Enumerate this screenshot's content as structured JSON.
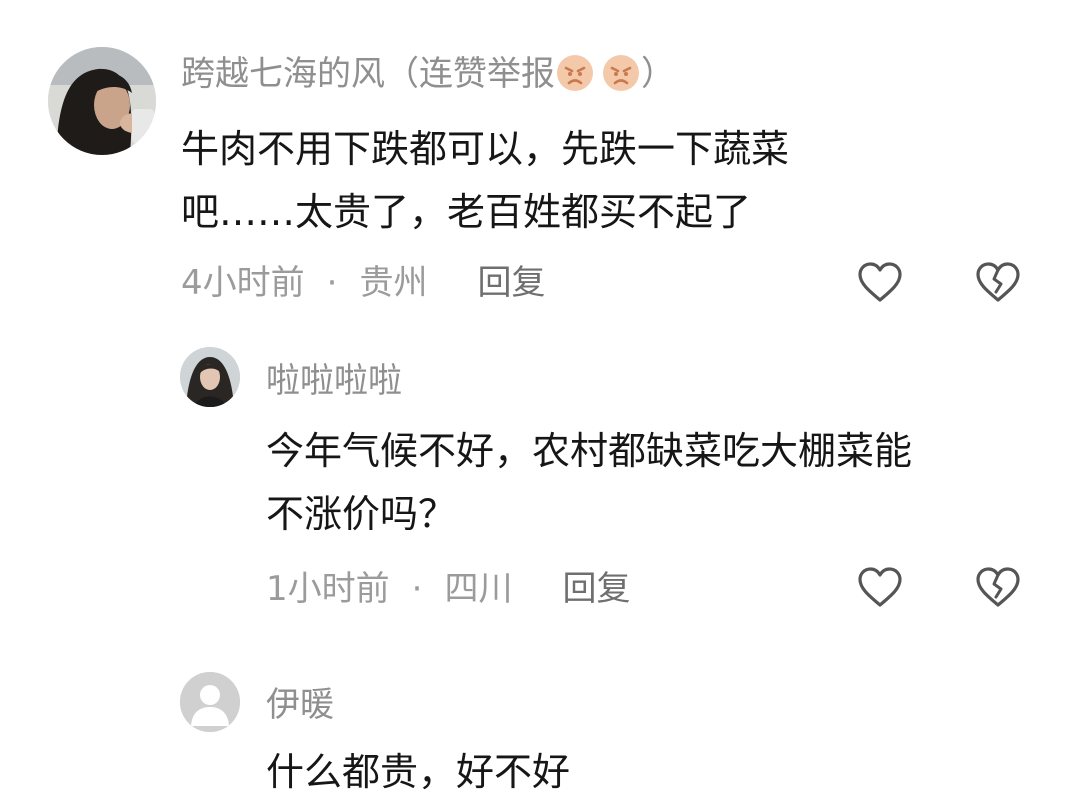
{
  "comments": [
    {
      "username": "跨越七海的风（连赞举报",
      "username_suffix": "）",
      "reaction_icons": [
        "angry-face-icon",
        "angry-face-icon"
      ],
      "content_lines": [
        "牛肉不用下跌都可以，先跌一下蔬菜",
        "吧……太贵了，老百姓都买不起了"
      ],
      "time": "4小时前",
      "separator": "·",
      "location": "贵州",
      "reply_label": "回复"
    },
    {
      "username": "啦啦啦啦",
      "content_lines": [
        "今年气候不好，农村都缺菜吃大棚菜能",
        "不涨价吗？"
      ],
      "time": "1小时前",
      "separator": "·",
      "location": "四川",
      "reply_label": "回复"
    },
    {
      "username": "伊暖",
      "content_lines": [
        "什么都贵，好不好"
      ]
    }
  ],
  "icons": {
    "like": "heart-outline-icon",
    "dislike": "broken-heart-icon"
  },
  "colors": {
    "username": "#8f8f8f",
    "content": "#161616",
    "meta": "#9b9b9b",
    "icon_stroke": "#555555",
    "emoji_face": "#f4c9a9",
    "emoji_feature": "#c9794f"
  }
}
